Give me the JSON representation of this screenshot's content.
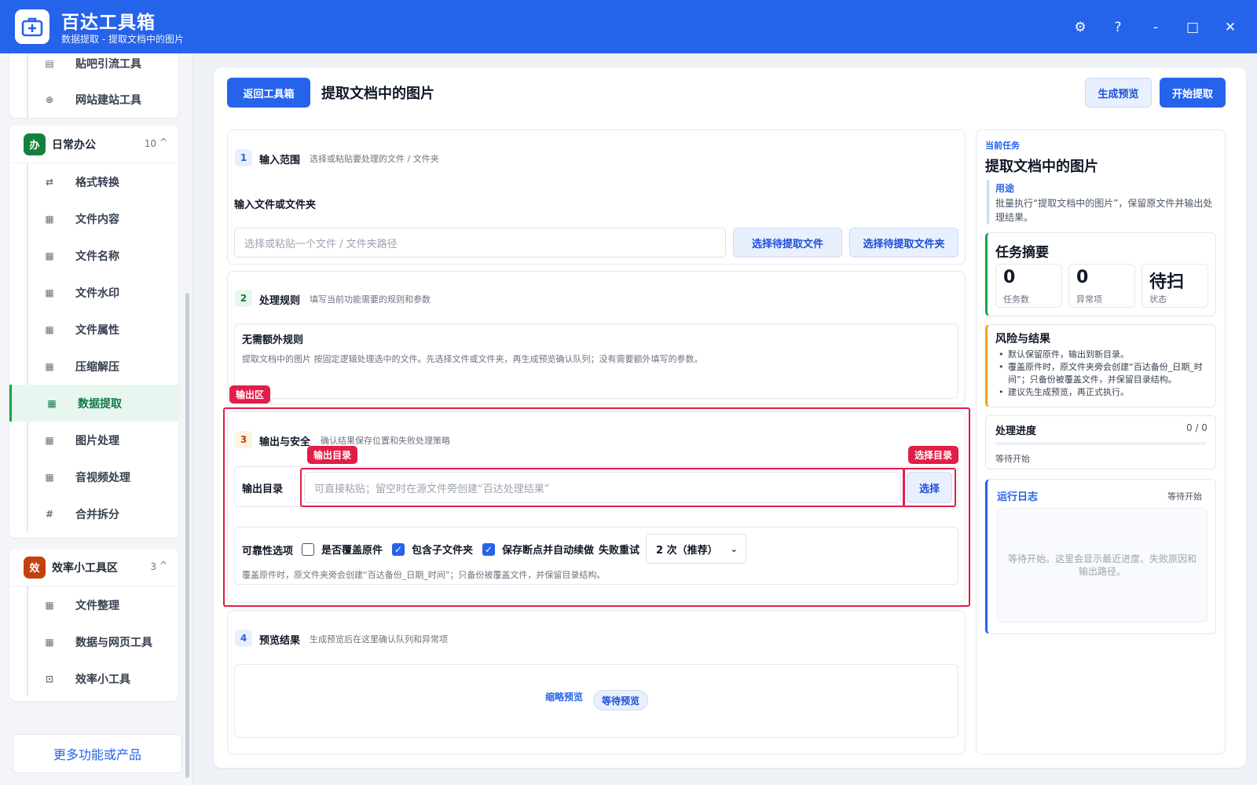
{
  "app": {
    "title": "百达工具箱",
    "subtitle": "数据提取 - 提取文档中的图片"
  },
  "window_controls": {
    "settings": "⚙",
    "help": "?",
    "minimize": "-",
    "maximize": "□",
    "close": "✕"
  },
  "sidebar": {
    "top_group_items": [
      {
        "label": "贴吧引流工具",
        "icon": "document-icon"
      },
      {
        "label": "网站建站工具",
        "icon": "globe-icon"
      }
    ],
    "office_group": {
      "badge": "办",
      "label": "日常办公",
      "count": "10",
      "caret": "^",
      "badge_color": "#15803d",
      "items": [
        {
          "label": "格式转换",
          "icon": "convert-icon"
        },
        {
          "label": "文件内容",
          "icon": "grid-icon"
        },
        {
          "label": "文件名称",
          "icon": "grid-icon"
        },
        {
          "label": "文件水印",
          "icon": "grid-icon"
        },
        {
          "label": "文件属性",
          "icon": "grid-icon"
        },
        {
          "label": "压缩解压",
          "icon": "grid-icon"
        },
        {
          "label": "数据提取",
          "icon": "grid-icon"
        },
        {
          "label": "图片处理",
          "icon": "grid-icon"
        },
        {
          "label": "音视频处理",
          "icon": "grid-icon"
        },
        {
          "label": "合并拆分",
          "icon": "hash-icon"
        }
      ],
      "active_item": "数据提取"
    },
    "efficiency_group": {
      "badge": "效",
      "label": "效率小工具区",
      "count": "3",
      "caret": "^",
      "badge_color": "#c2410c",
      "items": [
        {
          "label": "文件整理",
          "icon": "grid-icon"
        },
        {
          "label": "数据与网页工具",
          "icon": "grid-icon"
        },
        {
          "label": "效率小工具",
          "icon": "toolbox-icon"
        }
      ]
    },
    "more_button": "更多功能或产品"
  },
  "header": {
    "back_button": "返回工具箱",
    "page_title": "提取文档中的图片",
    "preview_button": "生成预览",
    "start_button": "开始提取"
  },
  "section1": {
    "num": "1",
    "title": "输入范围",
    "hint": "选择或粘贴要处理的文件 / 文件夹",
    "field_label": "输入文件或文件夹",
    "input_placeholder": "选择或粘贴一个文件 / 文件夹路径",
    "select_file_button": "选择待提取文件",
    "select_folder_button": "选择待提取文件夹"
  },
  "section2": {
    "num": "2",
    "title": "处理规则",
    "hint": "填写当前功能需要的规则和参数",
    "rule_title": "无需额外规则",
    "rule_desc": "提取文档中的图片 按固定逻辑处理选中的文件。先选择文件或文件夹，再生成预览确认队列；没有需要额外填写的参数。"
  },
  "section3": {
    "num": "3",
    "title": "输出与安全",
    "hint": "确认结果保存位置和失败处理策略",
    "output_label": "输出目录",
    "output_placeholder": "可直接粘贴；留空时在源文件旁创建“百达处理结果”",
    "choose_button": "选择",
    "reliability_label": "可靠性选项",
    "opt_overwrite": "是否覆盖原件",
    "opt_subfolders": "包含子文件夹",
    "opt_resume": "保存断点并自动续做",
    "retry_label": "失败重试",
    "retry_value": "2 次（推荐）",
    "opt_overwrite_checked": false,
    "opt_subfolders_checked": true,
    "opt_resume_checked": true,
    "note": "覆盖原件时，原文件夹旁会创建“百达备份_日期_时间”；只备份被覆盖文件，并保留目录结构。"
  },
  "annotations": {
    "output_area": "输出区",
    "output_dir": "输出目录",
    "choose_dir": "选择目录"
  },
  "section4": {
    "num": "4",
    "title": "预览结果",
    "hint": "生成预览后在这里确认队列和异常项",
    "thumb_label": "缩略预览",
    "waiting_badge": "等待预览"
  },
  "right_panel": {
    "current_task_label": "当前任务",
    "task_title": "提取文档中的图片",
    "usage_label": "用途",
    "usage_desc": "批量执行“提取文档中的图片”，保留原文件并输出处理结果。",
    "summary_title": "任务摘要",
    "stats": [
      {
        "value": "0",
        "label": "任务数"
      },
      {
        "value": "0",
        "label": "异常项"
      },
      {
        "value": "待扫",
        "label": "状态"
      }
    ],
    "risk_title": "风险与结果",
    "risk_items": [
      "默认保留原件，输出到新目录。",
      "覆盖原件时，原文件夹旁会创建“百达备份_日期_时间”；只备份被覆盖文件，并保留目录结构。",
      "建议先生成预览，再正式执行。"
    ],
    "progress_title": "处理进度",
    "progress_count": "0 / 0",
    "progress_fraction": 0,
    "progress_status": "等待开始",
    "log_title": "运行日志",
    "log_status": "等待开始",
    "log_placeholder": "等待开始。这里会显示最近进度、失败原因和输出路径。"
  }
}
